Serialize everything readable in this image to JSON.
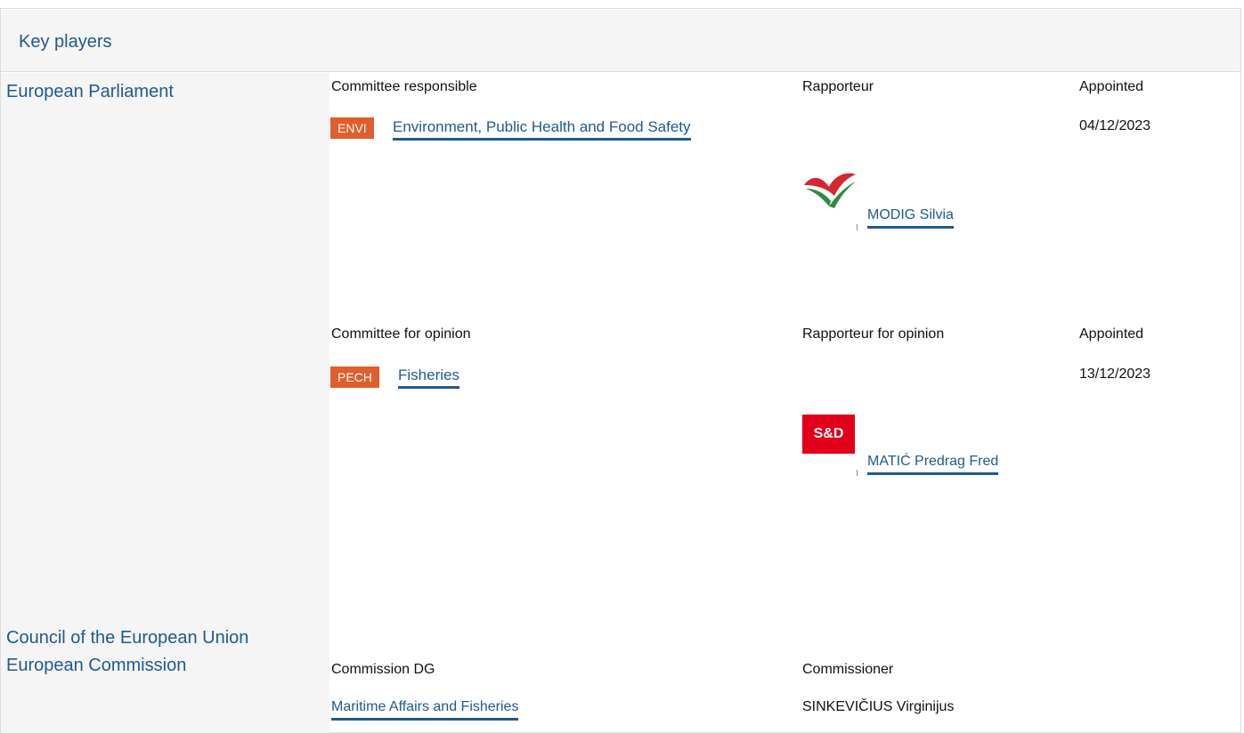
{
  "header": {
    "title": "Key players"
  },
  "institutions": {
    "parliament": "European Parliament",
    "council": "Council of the European Union",
    "commission": "European Commission"
  },
  "responsible": {
    "committee_label": "Committee responsible",
    "rapporteur_label": "Rapporteur",
    "appointed_label": "Appointed",
    "badge": "ENVI",
    "committee_name": "Environment, Public Health and Food Safety",
    "date": "04/12/2023",
    "rapporteur_name": "MODIG Silvia"
  },
  "opinion": {
    "committee_label": "Committee for opinion",
    "rapporteur_label": "Rapporteur for opinion",
    "appointed_label": "Appointed",
    "badge": "PECH",
    "committee_name": "Fisheries",
    "date": "13/12/2023",
    "rapporteur_name": "MATIĆ Predrag Fred",
    "group_logo_text": "S&D"
  },
  "commission": {
    "dg_label": "Commission DG",
    "commissioner_label": "Commissioner",
    "dg_name": "Maritime Affairs and Fisheries",
    "commissioner_name": "SINKEVIČIUS Virginijus"
  },
  "colors": {
    "link": "#1f5a8f",
    "badge": "#e05e2b",
    "sd_red": "#e2001a",
    "panel_bg": "#f5f5f5"
  }
}
